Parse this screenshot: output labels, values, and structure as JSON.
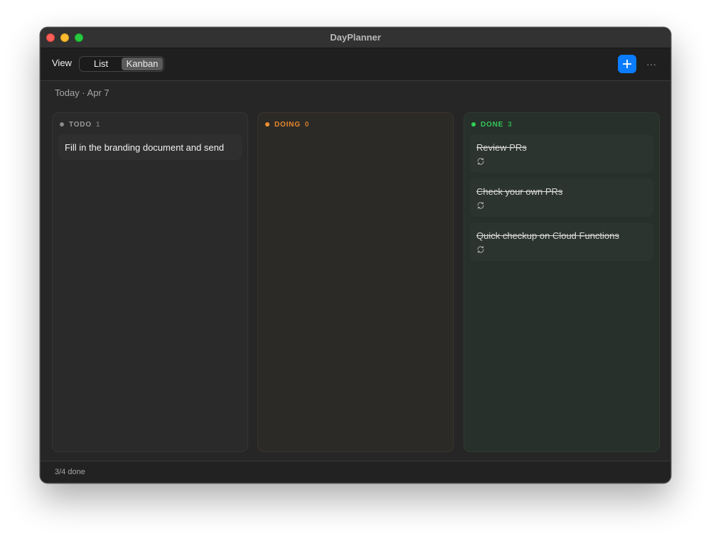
{
  "window": {
    "title": "DayPlanner"
  },
  "toolbar": {
    "view_label": "View",
    "view_options": [
      "List",
      "Kanban"
    ],
    "selected_view": "Kanban",
    "add_icon": "plus-icon",
    "more_icon": "ellipsis-icon",
    "more_glyph": "···"
  },
  "date_header": "Today · Apr 7",
  "columns": [
    {
      "name": "TODO",
      "count": "1",
      "color": "#8a8a8a",
      "cards": [
        {
          "title": "Fill in the branding document and send"
        }
      ]
    },
    {
      "name": "DOING",
      "count": "0",
      "color": "#f0912e",
      "cards": []
    },
    {
      "name": "DONE",
      "count": "3",
      "color": "#32d158",
      "cards": [
        {
          "title": "Review PRs",
          "done": true,
          "icon": "repeat-icon"
        },
        {
          "title": "Check your own PRs",
          "done": true,
          "icon": "repeat-icon"
        },
        {
          "title": "Quick checkup on Cloud Functions",
          "done": true,
          "icon": "repeat-icon"
        }
      ]
    }
  ],
  "status": "3/4 done"
}
